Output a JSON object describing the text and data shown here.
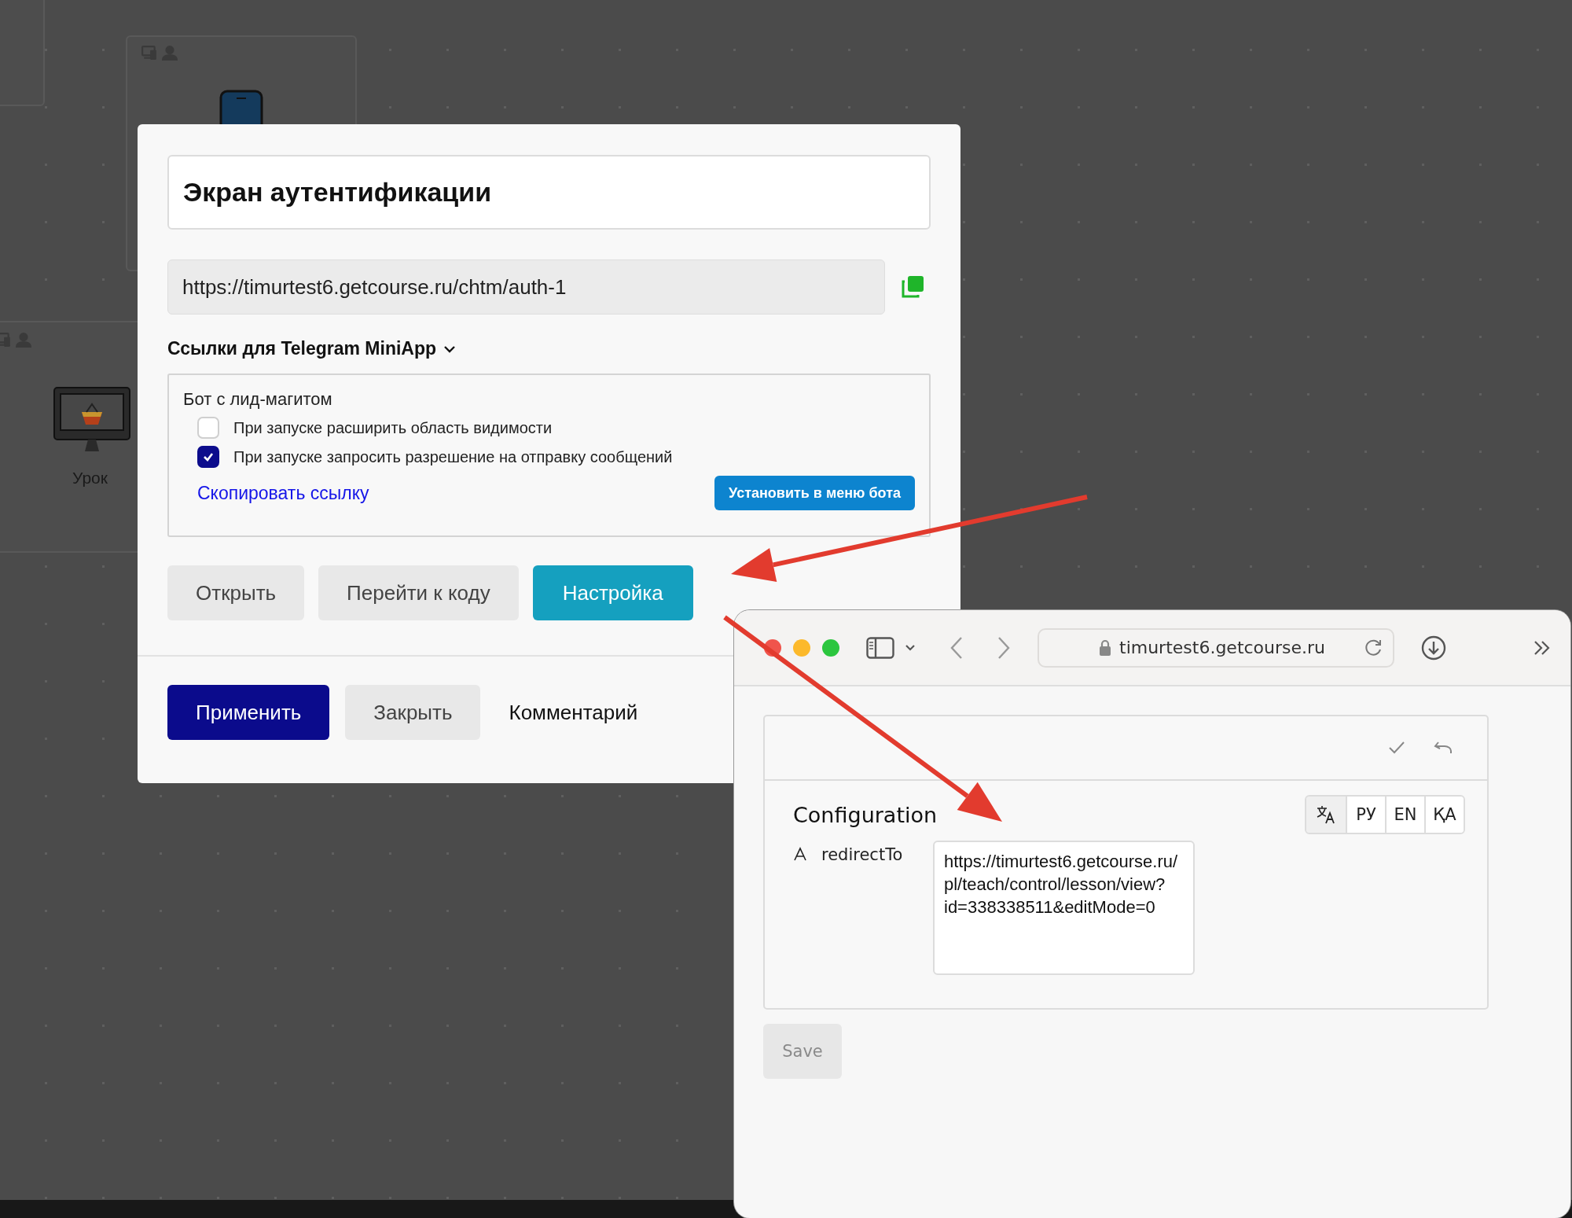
{
  "canvas": {
    "nodes": [
      {
        "kind": "blank"
      },
      {
        "kind": "phone"
      },
      {
        "kind": "lesson",
        "label": "Урок"
      }
    ]
  },
  "dialog": {
    "title_value": "Экран аутентификации",
    "url": "https://timurtest6.getcourse.ru/chtm/auth-1",
    "links_section": {
      "label": "Ссылки для Telegram MiniApp",
      "expanded": true
    },
    "bot": {
      "name": "Бот с лид-магитом",
      "options": [
        {
          "label": "При запуске расширить область видимости",
          "checked": false
        },
        {
          "label": "При запуске запросить разрешение на отправку сообщений",
          "checked": true
        }
      ],
      "copy_link": "Скопировать ссылку",
      "install_button": "Установить в меню бота"
    },
    "actions": [
      {
        "label": "Открыть",
        "kind": "secondary"
      },
      {
        "label": "Перейти к коду",
        "kind": "secondary"
      },
      {
        "label": "Настройка",
        "kind": "accent"
      }
    ],
    "footer": [
      {
        "label": "Применить",
        "kind": "primary"
      },
      {
        "label": "Закрыть",
        "kind": "secondary"
      },
      {
        "label": "Комментарий",
        "kind": "plain"
      }
    ]
  },
  "browser": {
    "address": "timurtest6.getcourse.ru",
    "config": {
      "title": "Configuration",
      "languages": [
        {
          "kind": "icon",
          "selected": true
        },
        {
          "kind": "text",
          "label": "РУ",
          "selected": false
        },
        {
          "kind": "text",
          "label": "EN",
          "selected": false
        },
        {
          "kind": "text",
          "label": "ҚА",
          "selected": false
        }
      ],
      "fields": [
        {
          "name": "redirectTo",
          "value": "https://timurtest6.getcourse.ru/pl/teach/control/lesson/view?id=338338511&editMode=0"
        }
      ],
      "save_button": {
        "label": "Save",
        "disabled": true
      }
    }
  }
}
